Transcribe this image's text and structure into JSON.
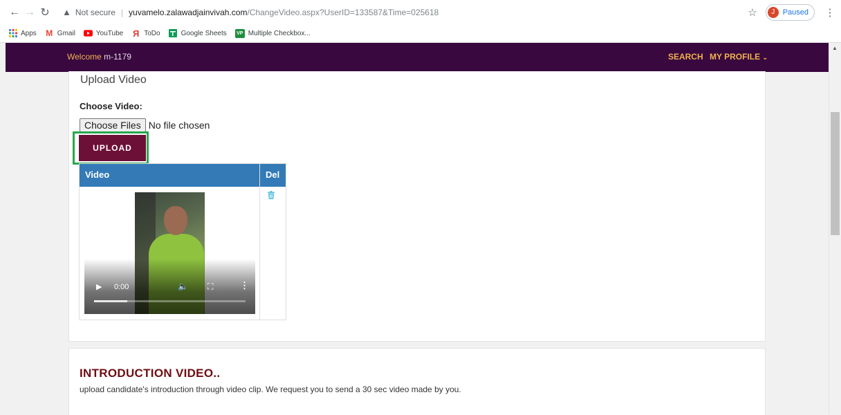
{
  "browser": {
    "security_label": "Not secure",
    "url_host": "yuvamelo.zalawadjainvivah.com",
    "url_path": "/ChangeVideo.aspx?UserID=133587&Time=025618",
    "profile_initial": "J",
    "profile_status": "Paused"
  },
  "bookmarks": [
    {
      "label": "Apps",
      "icon": "apps-grid-icon",
      "color": "#4285f4"
    },
    {
      "label": "Gmail",
      "icon": "gmail-icon",
      "color": "#ea4335"
    },
    {
      "label": "YouTube",
      "icon": "youtube-icon",
      "color": "#ff0000"
    },
    {
      "label": "ToDo",
      "icon": "todo-icon",
      "color": "#e53935"
    },
    {
      "label": "Google Sheets",
      "icon": "sheets-icon",
      "color": "#0f9d58"
    },
    {
      "label": "Multiple Checkbox...",
      "icon": "vp-icon",
      "color": "#1e8e3e"
    }
  ],
  "header": {
    "welcome_label": "Welcome",
    "username": "m-1179",
    "nav_search": "SEARCH",
    "nav_profile": "MY PROFILE",
    "brand_color": "#38083f",
    "accent_color": "#f0b14d"
  },
  "upload": {
    "title": "Upload Video",
    "choose_label": "Choose Video:",
    "file_button": "Choose Files",
    "file_status": "No file chosen",
    "upload_button": "UPLOAD",
    "button_color": "#6d1038"
  },
  "video_table": {
    "col_video": "Video",
    "col_del": "Del",
    "rows": [
      {
        "time": "0:00",
        "progress": 0.22
      }
    ]
  },
  "intro": {
    "title": "INTRODUCTION VIDEO..",
    "text": "upload candidate's introduction through video clip. We request you to send a 30 sec video made by you."
  }
}
